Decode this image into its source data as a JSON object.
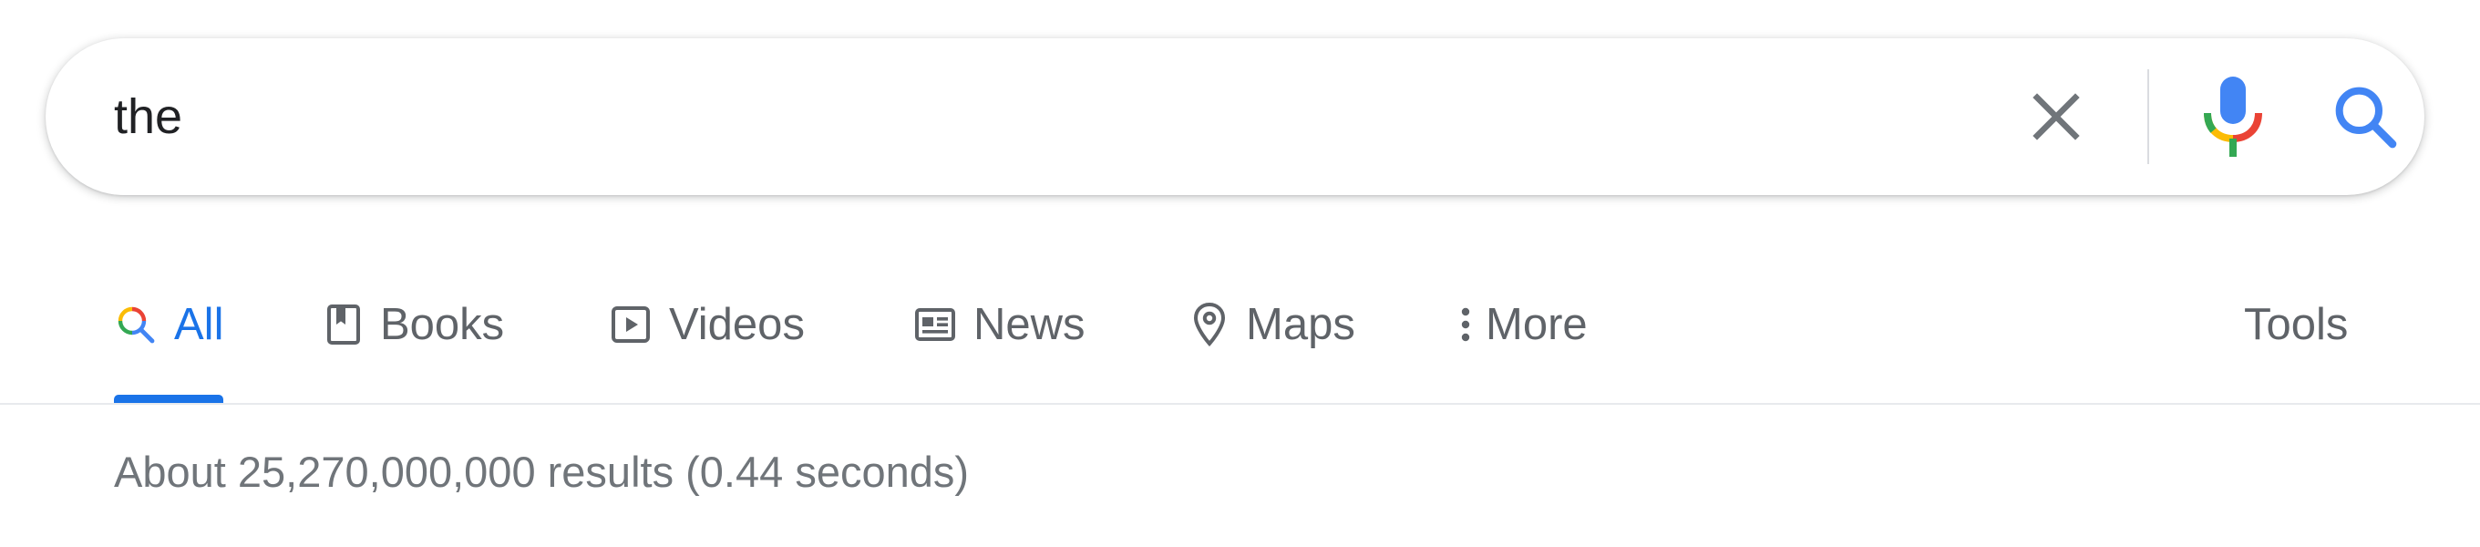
{
  "search": {
    "query": "the"
  },
  "tabs": [
    {
      "label": "All",
      "icon": "search-multicolor-icon",
      "active": true
    },
    {
      "label": "Books",
      "icon": "book-icon",
      "active": false
    },
    {
      "label": "Videos",
      "icon": "play-box-icon",
      "active": false
    },
    {
      "label": "News",
      "icon": "newspaper-icon",
      "active": false
    },
    {
      "label": "Maps",
      "icon": "map-pin-icon",
      "active": false
    },
    {
      "label": "More",
      "icon": "more-vert-icon",
      "active": false
    }
  ],
  "tools_label": "Tools",
  "result_stats": "About 25,270,000,000 results (0.44 seconds)",
  "colors": {
    "accent_blue": "#1a73e8",
    "google_blue": "#4285f4",
    "google_red": "#ea4335",
    "google_yellow": "#fbbc05",
    "google_green": "#34a853",
    "text_gray": "#5f6368",
    "stats_gray": "#70757a"
  }
}
